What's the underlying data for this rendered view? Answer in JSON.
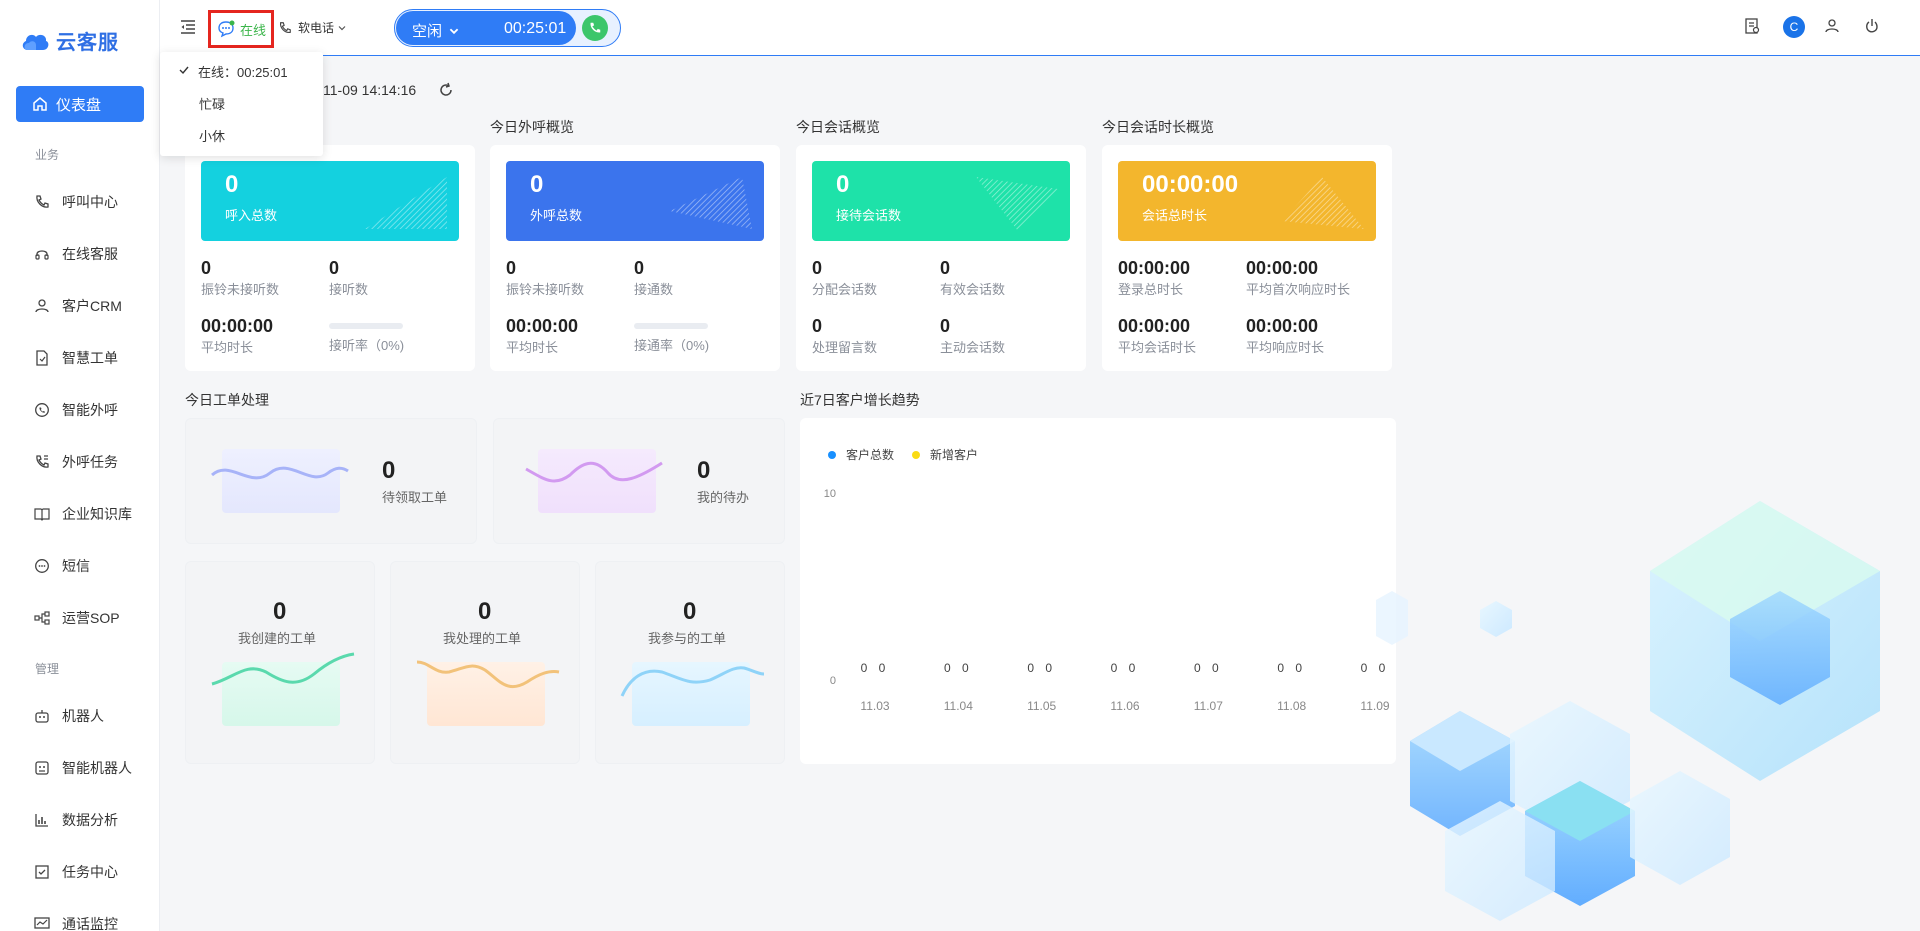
{
  "app": {
    "name": "云客服"
  },
  "sidebar": {
    "active": "仪表盘",
    "groups": [
      "业务",
      "管理"
    ],
    "items": [
      {
        "label": "呼叫中心",
        "icon": "phone-icon"
      },
      {
        "label": "在线客服",
        "icon": "headset-icon"
      },
      {
        "label": "客户CRM",
        "icon": "user-icon"
      },
      {
        "label": "智慧工单",
        "icon": "document-icon"
      },
      {
        "label": "智能外呼",
        "icon": "whatsapp-icon"
      },
      {
        "label": "外呼任务",
        "icon": "phone-task-icon"
      },
      {
        "label": "企业知识库",
        "icon": "book-icon"
      },
      {
        "label": "短信",
        "icon": "sms-icon"
      },
      {
        "label": "运营SOP",
        "icon": "flow-icon"
      },
      {
        "label": "机器人",
        "icon": "robot-icon"
      },
      {
        "label": "智能机器人",
        "icon": "smart-robot-icon"
      },
      {
        "label": "数据分析",
        "icon": "bar-chart-icon"
      },
      {
        "label": "任务中心",
        "icon": "checkbox-icon"
      },
      {
        "label": "通话监控",
        "icon": "monitor-icon"
      }
    ]
  },
  "header": {
    "status": "在线",
    "soft_phone": "软电话",
    "call_state": "空闲",
    "call_timer": "00:25:01",
    "avatar_letter": "C"
  },
  "status_menu": {
    "items": [
      "在线：00:25:01",
      "忙碌",
      "小休"
    ]
  },
  "dashboard": {
    "timestamp": "11-09 14:14:16",
    "panels": [
      {
        "title": "",
        "banner_value": "0",
        "banner_label": "呼入总数",
        "color": "#14d1df",
        "metrics": [
          {
            "value": "0",
            "label": "振铃未接听数"
          },
          {
            "value": "0",
            "label": "接听数"
          },
          {
            "value": "00:00:00",
            "label": "平均时长"
          },
          {
            "value": "",
            "label": "接听率（0%)"
          }
        ]
      },
      {
        "title": "今日外呼概览",
        "banner_value": "0",
        "banner_label": "外呼总数",
        "color": "#3b74ed",
        "metrics": [
          {
            "value": "0",
            "label": "振铃未接听数"
          },
          {
            "value": "0",
            "label": "接通数"
          },
          {
            "value": "00:00:00",
            "label": "平均时长"
          },
          {
            "value": "",
            "label": "接通率（0%)"
          }
        ]
      },
      {
        "title": "今日会话概览",
        "banner_value": "0",
        "banner_label": "接待会话数",
        "color": "#1ee2a9",
        "metrics": [
          {
            "value": "0",
            "label": "分配会话数"
          },
          {
            "value": "0",
            "label": "有效会话数"
          },
          {
            "value": "0",
            "label": "处理留言数"
          },
          {
            "value": "0",
            "label": "主动会话数"
          }
        ]
      },
      {
        "title": "今日会话时长概览",
        "banner_value": "00:00:00",
        "banner_label": "会话总时长",
        "color": "#f3b62d",
        "metrics": [
          {
            "value": "00:00:00",
            "label": "登录总时长"
          },
          {
            "value": "00:00:00",
            "label": "平均首次响应时长"
          },
          {
            "value": "00:00:00",
            "label": "平均会话时长"
          },
          {
            "value": "00:00:00",
            "label": "平均响应时长"
          }
        ]
      }
    ],
    "work_orders": {
      "title": "今日工单处理",
      "items": [
        {
          "value": "0",
          "label": "待领取工单"
        },
        {
          "value": "0",
          "label": "我的待办"
        },
        {
          "value": "0",
          "label": "我创建的工单"
        },
        {
          "value": "0",
          "label": "我处理的工单"
        },
        {
          "value": "0",
          "label": "我参与的工单"
        }
      ]
    }
  },
  "chart_data": {
    "type": "bar",
    "title": "近7日客户增长趋势",
    "categories": [
      "11.03",
      "11.04",
      "11.05",
      "11.06",
      "11.07",
      "11.08",
      "11.09"
    ],
    "series": [
      {
        "name": "客户总数",
        "values": [
          0,
          0,
          0,
          0,
          0,
          0,
          0
        ],
        "color": "#1890ff"
      },
      {
        "name": "新增客户",
        "values": [
          0,
          0,
          0,
          0,
          0,
          0,
          0
        ],
        "color": "#fadb14"
      }
    ],
    "ylim": [
      0,
      10
    ],
    "yticks": [
      "10",
      "0"
    ],
    "legend": "top-left"
  }
}
